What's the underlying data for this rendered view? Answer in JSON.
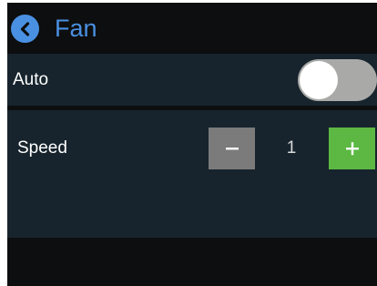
{
  "header": {
    "back_icon": "chevron-left-icon",
    "title": "Fan"
  },
  "auto_row": {
    "label": "Auto",
    "toggle_on": false
  },
  "speed_row": {
    "label": "Speed",
    "value": "1",
    "minus_icon": "minus-icon",
    "plus_icon": "plus-icon"
  },
  "colors": {
    "accent": "#4a90e2",
    "background": "#0d0e0f",
    "panel": "#17242d",
    "toggle_off": "#a9aaa8",
    "minus_button": "#7b7b7b",
    "plus_button": "#5cb843"
  }
}
